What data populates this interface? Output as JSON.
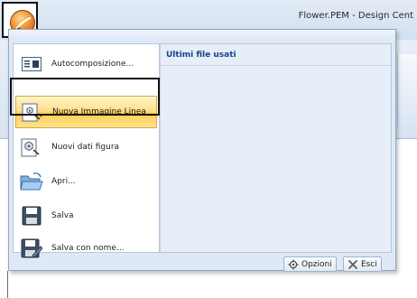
{
  "window": {
    "title": "Flower.PEM - Design Cent"
  },
  "app_menu": {
    "commands": [
      {
        "label": "Autocomposizione...",
        "icon": "autocompose-icon"
      },
      {
        "label": "Nuova Immagine Linea",
        "icon": "new-line-image-icon",
        "active": true
      },
      {
        "label": "Nuovi dati figura",
        "icon": "new-figure-data-icon"
      },
      {
        "label": "Apri...",
        "icon": "open-folder-icon"
      },
      {
        "label": "Salva",
        "icon": "save-icon"
      },
      {
        "label": "Salva con nome...",
        "icon": "save-as-icon"
      }
    ],
    "recent_header": "Ultimi file usati",
    "footer": {
      "options_label": "Opzioni",
      "exit_label": "Esci"
    }
  },
  "colors": {
    "accent_highlight": "#ffd764",
    "panel_background": "#dfe9f5",
    "header_text": "#15428b"
  }
}
